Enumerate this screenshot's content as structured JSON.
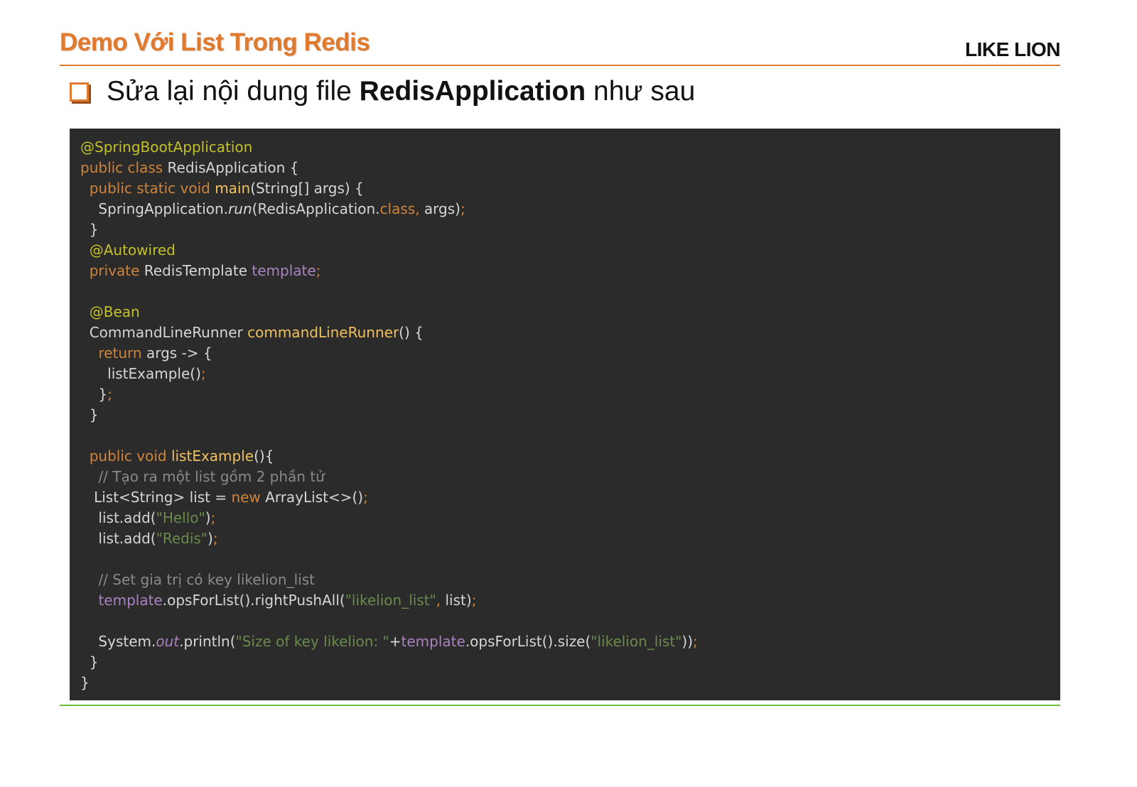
{
  "slide": {
    "title": "Demo Với List Trong Redis",
    "brand": "LIKE LION"
  },
  "heading": {
    "prefix": "Sửa lại nội dung file ",
    "bold": "RedisApplication",
    "suffix": " như sau"
  },
  "colors": {
    "title_orange": "#e07a2e",
    "bottom_rule_green": "#6cbf3a",
    "code_background": "#2b2b2b"
  },
  "code": {
    "lines": [
      [
        [
          "ann",
          "@SpringBootApplication"
        ]
      ],
      [
        [
          "kw",
          "public class "
        ],
        [
          "pl",
          "RedisApplication {"
        ]
      ],
      [
        [
          "pl",
          "  "
        ],
        [
          "kw",
          "public static void "
        ],
        [
          "fn",
          "main"
        ],
        [
          "pl",
          "(String[] args) {"
        ]
      ],
      [
        [
          "pl",
          "    SpringApplication."
        ],
        [
          "it",
          "run"
        ],
        [
          "pl",
          "(RedisApplication."
        ],
        [
          "kw",
          "class, "
        ],
        [
          "pl",
          "args)"
        ],
        [
          "kw",
          ";"
        ]
      ],
      [
        [
          "pl",
          "  }"
        ]
      ],
      [
        [
          "pl",
          "  "
        ],
        [
          "ann",
          "@Autowired"
        ]
      ],
      [
        [
          "pl",
          "  "
        ],
        [
          "kw",
          "private "
        ],
        [
          "pl",
          "RedisTemplate "
        ],
        [
          "fld",
          "template"
        ],
        [
          "kw",
          ";"
        ]
      ],
      [],
      [
        [
          "pl",
          "  "
        ],
        [
          "ann",
          "@Bean"
        ]
      ],
      [
        [
          "pl",
          "  CommandLineRunner "
        ],
        [
          "fn",
          "commandLineRunner"
        ],
        [
          "pl",
          "() {"
        ]
      ],
      [
        [
          "pl",
          "    "
        ],
        [
          "kw",
          "return "
        ],
        [
          "pl",
          "args -> {"
        ]
      ],
      [
        [
          "pl",
          "      listExample()"
        ],
        [
          "kw",
          ";"
        ]
      ],
      [
        [
          "pl",
          "    }"
        ],
        [
          "kw",
          ";"
        ]
      ],
      [
        [
          "pl",
          "  }"
        ]
      ],
      [],
      [
        [
          "pl",
          "  "
        ],
        [
          "kw",
          "public void "
        ],
        [
          "fn",
          "listExample"
        ],
        [
          "pl",
          "(){"
        ]
      ],
      [
        [
          "pl",
          "    "
        ],
        [
          "com",
          "// Tạo ra một list gồm 2 phần tử"
        ]
      ],
      [
        [
          "pl",
          "   List<String> list = "
        ],
        [
          "kw",
          "new "
        ],
        [
          "pl",
          "ArrayList<>()"
        ],
        [
          "kw",
          ";"
        ]
      ],
      [
        [
          "pl",
          "    list.add("
        ],
        [
          "str",
          "\"Hello\""
        ],
        [
          "pl",
          ")"
        ],
        [
          "kw",
          ";"
        ]
      ],
      [
        [
          "pl",
          "    list.add("
        ],
        [
          "str",
          "\"Redis\""
        ],
        [
          "pl",
          ")"
        ],
        [
          "kw",
          ";"
        ]
      ],
      [],
      [
        [
          "pl",
          "    "
        ],
        [
          "com",
          "// Set gia trị có key likelion_list"
        ]
      ],
      [
        [
          "pl",
          "    "
        ],
        [
          "fld",
          "template"
        ],
        [
          "pl",
          ".opsForList().rightPushAll("
        ],
        [
          "str",
          "\"likelion_list\""
        ],
        [
          "kw",
          ", "
        ],
        [
          "pl",
          "list)"
        ],
        [
          "kw",
          ";"
        ]
      ],
      [],
      [
        [
          "pl",
          "    System."
        ],
        [
          "fldit",
          "out"
        ],
        [
          "pl",
          ".println("
        ],
        [
          "str",
          "\"Size of key likelion: \""
        ],
        [
          "pl",
          "+"
        ],
        [
          "fld",
          "template"
        ],
        [
          "pl",
          ".opsForList().size("
        ],
        [
          "str",
          "\"likelion_list\""
        ],
        [
          "pl",
          "))"
        ],
        [
          "kw",
          ";"
        ]
      ],
      [
        [
          "pl",
          "  }"
        ]
      ],
      [
        [
          "pl",
          "}"
        ]
      ]
    ]
  }
}
